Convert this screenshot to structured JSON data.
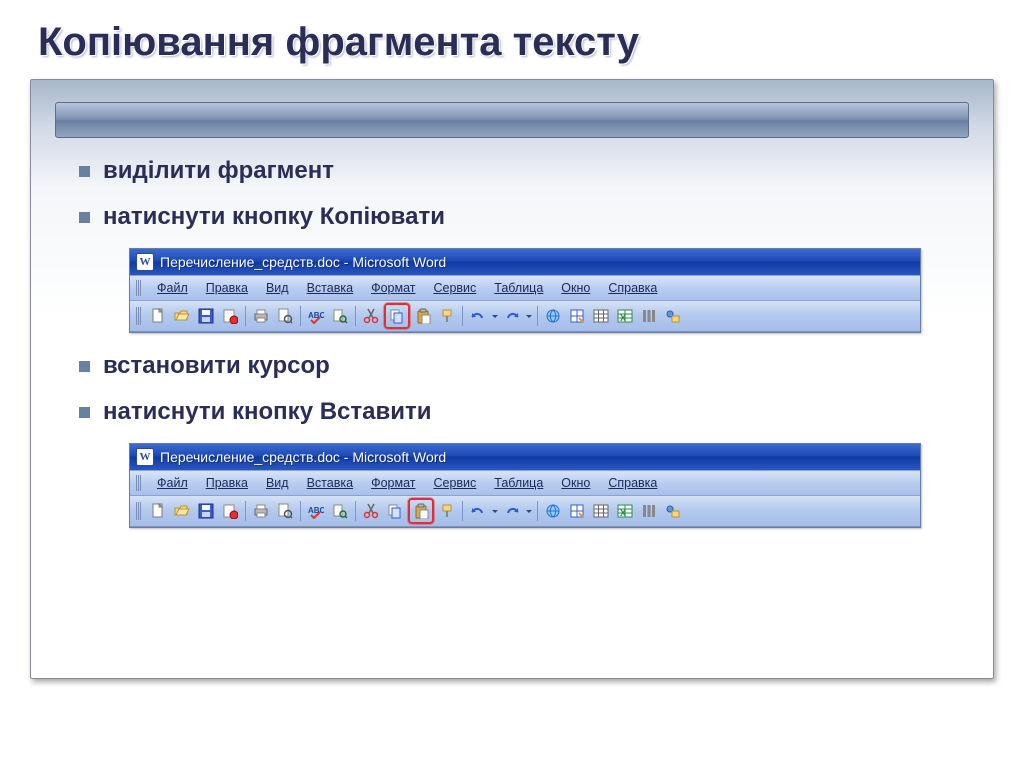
{
  "slide": {
    "title": "Копіювання фрагмента тексту",
    "steps": [
      "виділити фрагмент",
      "натиснути кнопку Копіювати",
      "встановити курсор",
      "натиснути кнопку Вставити"
    ]
  },
  "word_window": {
    "title": "Перечисление_средств.doc - Microsoft Word",
    "menus": [
      "Файл",
      "Правка",
      "Вид",
      "Вставка",
      "Формат",
      "Сервис",
      "Таблица",
      "Окно",
      "Справка"
    ],
    "toolbar_icons": [
      "new-doc",
      "open",
      "save",
      "permission",
      "sep",
      "print",
      "print-preview",
      "sep",
      "spellcheck",
      "research",
      "sep",
      "cut",
      "copy",
      "paste",
      "format-painter",
      "sep",
      "undo",
      "redo",
      "sep",
      "insert-hyperlink",
      "tables-borders",
      "insert-table",
      "insert-excel",
      "columns",
      "drawing"
    ],
    "highlight_copy": "copy",
    "highlight_paste": "paste"
  }
}
